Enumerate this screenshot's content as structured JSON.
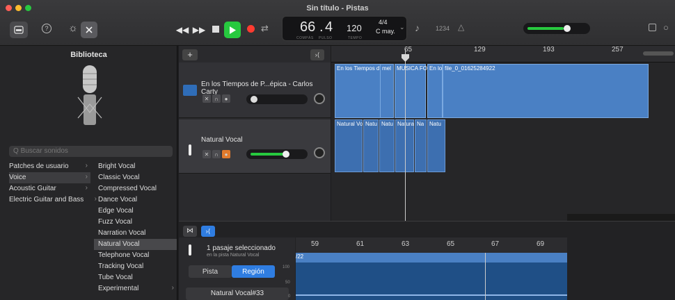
{
  "window": {
    "title": "Sin título - Pistas"
  },
  "lcd": {
    "bar": "66",
    "beat": "4",
    "bar_label": "COMPÁS",
    "beat_label": "PULSO",
    "tempo": "120",
    "tempo_label": "TEMPO",
    "signature": "4/4",
    "key": "C may."
  },
  "toolbar": {
    "count_in": "1234"
  },
  "library": {
    "title": "Biblioteca",
    "search_placeholder": "Buscar sonidos",
    "categories": [
      "Patches de usuario",
      "Voice",
      "Acoustic Guitar",
      "Electric Guitar and Bass"
    ],
    "selected_category": "Voice",
    "patches": [
      "Bright Vocal",
      "Classic Vocal",
      "Compressed Vocal",
      "Dance Vocal",
      "Edge Vocal",
      "Fuzz Vocal",
      "Narration Vocal",
      "Natural Vocal",
      "Telephone Vocal",
      "Tracking Vocal",
      "Tube Vocal",
      "Experimental"
    ],
    "selected_patch": "Natural Vocal"
  },
  "tracks": [
    {
      "name": "En los Tiempos de P...épica  - Carlos Carty"
    },
    {
      "name": "Natural Vocal"
    }
  ],
  "ruler": {
    "marks": [
      "65",
      "129",
      "193",
      "257"
    ]
  },
  "regions_track1": [
    "En los Tiempos d",
    "mel",
    "MUSICA FO",
    "En lo",
    "file_0_01625284922"
  ],
  "regions_track2": [
    "Natural Vo",
    "Natu",
    "Natu",
    "Natura",
    "Na",
    "Natu"
  ],
  "editor": {
    "info": "1 pasaje seleccionado",
    "sub": "en la pista Natural Vocal",
    "tab_track": "Pista",
    "tab_region": "Región",
    "region_name": "Natural Vocal#33",
    "ruler_marks": [
      "59",
      "61",
      "63",
      "65",
      "67",
      "69"
    ],
    "region_label": "/22",
    "amp_labels": [
      "100",
      "50",
      "0"
    ]
  },
  "colors": {
    "accent": "#2f7de1",
    "play": "#27c93f",
    "record": "#ff3b30",
    "region": "#4a80c4"
  }
}
